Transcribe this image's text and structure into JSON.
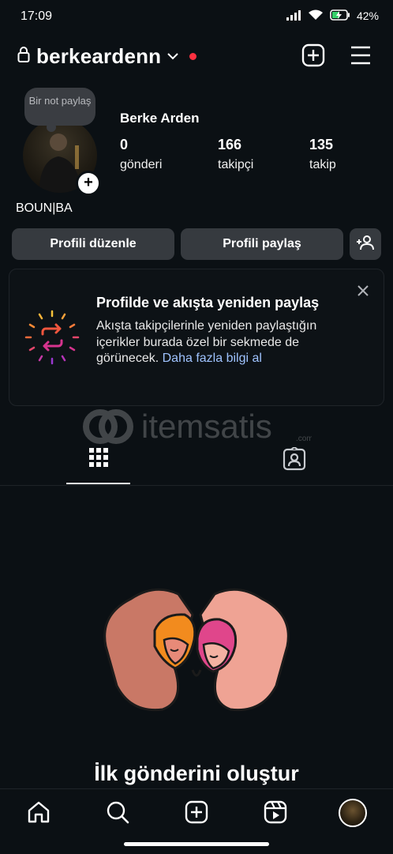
{
  "status_bar": {
    "time": "17:09",
    "battery": "42%",
    "icons": [
      "signal-icon",
      "wifi-icon",
      "battery-charging-icon"
    ]
  },
  "header": {
    "username": "berkeardenn",
    "icons": [
      "lock-icon",
      "chevron-down-icon",
      "notification-dot",
      "create-icon",
      "menu-icon"
    ]
  },
  "profile": {
    "note": "Bir not paylaş",
    "full_name": "Berke Arden",
    "stats": [
      {
        "value": "0",
        "label": "gönderi"
      },
      {
        "value": "166",
        "label": "takipçi"
      },
      {
        "value": "135",
        "label": "takip"
      }
    ],
    "bio": "BOUN|BA"
  },
  "actions": {
    "edit_profile": "Profili düzenle",
    "share_profile": "Profili paylaş"
  },
  "repost_card": {
    "title": "Profilde ve akışta yeniden paylaş",
    "body": "Akışta takipçilerinle yeniden paylaştığın içerikler burada özel bir sekmede de görünecek.",
    "link": "Daha fazla bilgi al"
  },
  "watermark": {
    "text": "itemsatis",
    "suffix": ".com"
  },
  "tabs": [
    {
      "name": "grid",
      "active": true
    },
    {
      "name": "tagged",
      "active": false
    }
  ],
  "empty_state": {
    "title": "İlk gönderini oluştur"
  },
  "bottom_nav": [
    "home-icon",
    "search-icon",
    "create-icon",
    "reels-icon",
    "profile-avatar"
  ],
  "colors": {
    "background": "#0b1014",
    "button": "#363a3f",
    "link": "#9fc3ff",
    "notification": "#ff3040"
  }
}
